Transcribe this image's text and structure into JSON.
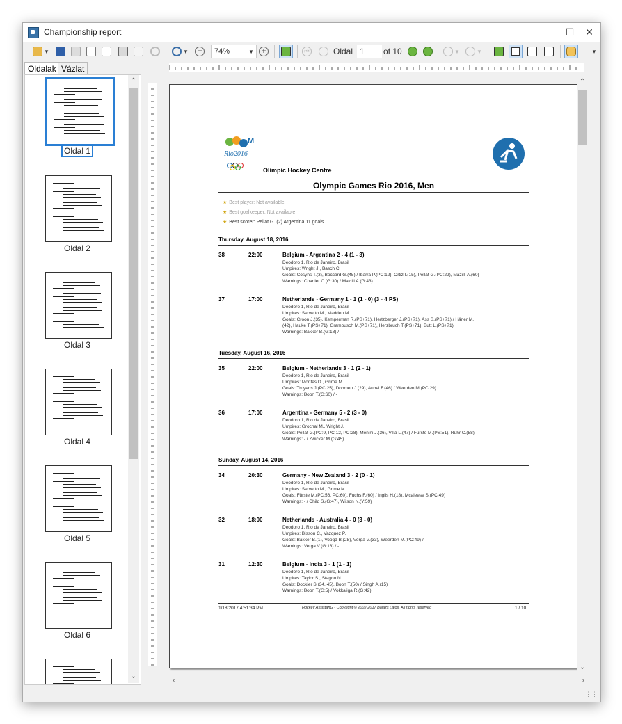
{
  "window": {
    "title": "Championship report"
  },
  "toolbar": {
    "zoom": "74%",
    "page_label": "Oldal",
    "page_value": "1",
    "page_of": "of 10"
  },
  "tabs": [
    "Oldalak",
    "Vázlat"
  ],
  "thumbnails": [
    "Oldal 1",
    "Oldal 2",
    "Oldal 3",
    "Oldal 4",
    "Oldal 5",
    "Oldal 6"
  ],
  "report": {
    "venue": "Olimpic Hockey Centre",
    "title": "Olympic Games Rio 2016, Men",
    "best_player": "Best player: Not available",
    "best_goalkeeper": "Best goalkeeper: Not available",
    "best_scorer": "Best scorer: Pellat G. (2) Argentina 11 goals",
    "days": [
      {
        "date": "Thursday, August 18, 2016",
        "matches": [
          {
            "num": "38",
            "time": "22:00",
            "title": "Belgium - Argentina   2 - 4 (1 - 3)",
            "lines": [
              "Deodoro 1, Rio de Janeiro, Brasil",
              "Umpires: Wright J., Basch C.",
              "Goals: Cosyns T.(3), Boccard G.(45) / Ibarra P.(PC:12), Ortiz I.(15), Pellat G.(PC:22), Mazilli A.(60)",
              "Warnings: Charlier C.(G:30) / Mazilli A.(G:43)"
            ]
          },
          {
            "num": "37",
            "time": "17:00",
            "title": "Netherlands - Germany   1 - 1 (1 - 0) (3 - 4 PS)",
            "lines": [
              "Deodoro 1, Rio de Janeiro, Brasil",
              "Umpires: Servetto M., Madden M.",
              "Goals: Croon J.(35), Kemperman R.(PS+71), Hertzberger J.(PS+71), Ass S.(PS+71) / Häner M.",
              "(42), Hauke T.(PS+71), Grambusch M.(PS+71), Herzbruch T.(PS+71), Butt L.(PS+71)",
              "Warnings: Bakker B.(G:18) / -"
            ]
          }
        ]
      },
      {
        "date": "Tuesday, August 16, 2016",
        "matches": [
          {
            "num": "35",
            "time": "22:00",
            "title": "Belgium - Netherlands   3 - 1 (2 - 1)",
            "lines": [
              "Deodoro 1, Rio de Janeiro, Brasil",
              "Umpires: Montes D., Grime M.",
              "Goals: Truyens J.(PC:25), Dohmen J.(29), Aubel F.(46) / Weerden M.(PC:29)",
              "Warnings: Boon T.(G:60) / -"
            ]
          },
          {
            "num": "36",
            "time": "17:00",
            "title": "Argentina - Germany   5 - 2 (3 - 0)",
            "lines": [
              "Deodoro 1, Rio de Janeiro, Brasil",
              "Umpires: Grochal M., Wright J.",
              "Goals: Pellat G.(PC:9, PC:12, PC:28), Menini J.(36), Villa L.(47) / Fürste M.(PS:51), Rühr C.(58)",
              "Warnings: - / Zwicker M.(G:45)"
            ]
          }
        ]
      },
      {
        "date": "Sunday, August 14, 2016",
        "matches": [
          {
            "num": "34",
            "time": "20:30",
            "title": "Germany - New Zealand   3 - 2 (0 - 1)",
            "lines": [
              "Deodoro 1, Rio de Janeiro, Brasil",
              "Umpires: Servetto M., Grime M.",
              "Goals: Fürste M.(PC:56, PC:60), Fuchs F.(60) / Inglis H.(18), Mcaleese S.(PC:49)",
              "Warnings: - / Child S.(G:47), Wilson N.(Y:59)"
            ]
          },
          {
            "num": "32",
            "time": "18:00",
            "title": "Netherlands - Australia   4 - 0 (3 - 0)",
            "lines": [
              "Deodoro 1, Rio de Janeiro, Brasil",
              "Umpires: Bisson C., Vazquez P.",
              "Goals: Bakker B.(1), Voogd B.(28), Verga V.(33), Weerden M.(PC:49) / -",
              "Warnings: Verga V.(G:18) / -"
            ]
          },
          {
            "num": "31",
            "time": "12:30",
            "title": "Belgium - India   3 - 1 (1 - 1)",
            "lines": [
              "Deodoro 1, Rio de Janeiro, Brasil",
              "Umpires: Taylor S., Stagno N.",
              "Goals: Dockier S.(34, 45), Boon T.(50) / Singh A.(15)",
              "Warnings: Boon T.(G:5) / Vokkaliga R.(G:42)"
            ]
          }
        ]
      }
    ],
    "footer_left": "1/18/2017 4:51:34 PM",
    "footer_center": "Hockey AssistanG - Copyright © 2002-2017 Balázs Lajos. All rights reserved",
    "footer_right": "1 / 10"
  },
  "colors": {
    "accent": "#2a7fd4",
    "logo_blue": "#1f6fae",
    "logo_green": "#6bb540",
    "logo_orange": "#f29d1f"
  }
}
